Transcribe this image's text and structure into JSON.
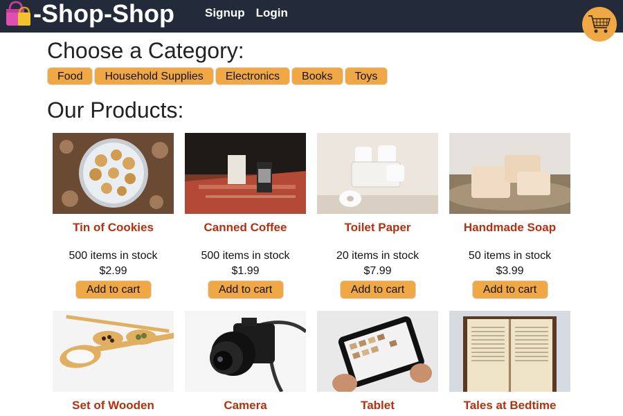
{
  "app": {
    "title": "-Shop-Shop",
    "logo_icon": "shopping-bags-icon"
  },
  "nav": {
    "signup": "Signup",
    "login": "Login"
  },
  "cart": {
    "icon": "shopping-cart-icon",
    "accent": "#f0a845"
  },
  "categories": {
    "heading": "Choose a Category:",
    "items": [
      "Food",
      "Household Supplies",
      "Electronics",
      "Books",
      "Toys"
    ]
  },
  "products": {
    "heading": "Our Products:",
    "add_label": "Add to cart",
    "items": [
      {
        "name": "Tin of Cookies",
        "stock": "500 items in stock",
        "price": "$2.99"
      },
      {
        "name": "Canned Coffee",
        "stock": "500 items in stock",
        "price": "$1.99"
      },
      {
        "name": "Toilet Paper",
        "stock": "20 items in stock",
        "price": "$7.99"
      },
      {
        "name": "Handmade Soap",
        "stock": "50 items in stock",
        "price": "$3.99"
      },
      {
        "name": "Set of Wooden"
      },
      {
        "name": "Camera"
      },
      {
        "name": "Tablet"
      },
      {
        "name": "Tales at Bedtime"
      }
    ]
  },
  "colors": {
    "header": "#232b3a",
    "accent": "#f0a845",
    "product_name": "#b5300e"
  }
}
